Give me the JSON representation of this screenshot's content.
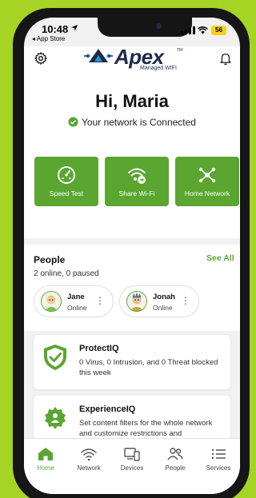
{
  "status_bar": {
    "time": "10:48",
    "back_app": "◂ App Store",
    "battery": "56"
  },
  "header": {
    "logo_word": "Apex",
    "logo_tm": "TM",
    "logo_sub": "Managed WIFI",
    "greeting": "Hi, Maria",
    "status": "Your network is Connected"
  },
  "actions": [
    {
      "label": "Speed Test"
    },
    {
      "label": "Share Wi-Fi"
    },
    {
      "label": "Home Network"
    }
  ],
  "people": {
    "title": "People",
    "see_all": "See All",
    "summary": "2 online, 0 paused",
    "members": [
      {
        "name": "Jane",
        "status": "Online"
      },
      {
        "name": "Jonah",
        "status": "Online"
      }
    ]
  },
  "features": [
    {
      "title": "ProtectIQ",
      "description": "0 Virus, 0 Intrusion, and 0 Threat blocked this week"
    },
    {
      "title": "ExperienceIQ",
      "description": "Set content filters for the whole network and customize restrictions and"
    }
  ],
  "tabs": [
    {
      "label": "Home",
      "icon": "home-icon",
      "active": true
    },
    {
      "label": "Network",
      "icon": "wifi-icon"
    },
    {
      "label": "Devices",
      "icon": "devices-icon"
    },
    {
      "label": "People",
      "icon": "people-icon"
    },
    {
      "label": "Services",
      "icon": "list-icon"
    }
  ],
  "colors": {
    "accent": "#5aa630",
    "brand": "#1d2a4a",
    "background": "#a6d425"
  }
}
